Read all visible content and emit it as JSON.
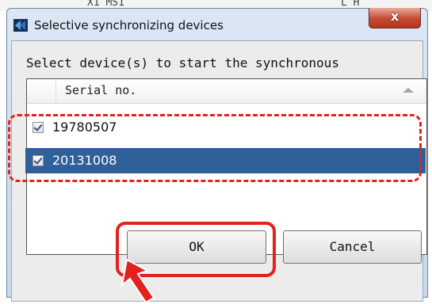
{
  "background": {
    "fragment_left": "X1 MS1",
    "fragment_right": "L H"
  },
  "window": {
    "title": "Selective synchronizing devices",
    "close_label": "x",
    "icon": "app-logo-icon"
  },
  "prompt": "Select device(s) to start the synchronous",
  "list": {
    "column_header": "Serial no.",
    "sort_icon": "sort-ascending-icon",
    "rows": [
      {
        "serial": "19780507",
        "checked": true,
        "selected": false
      },
      {
        "serial": "20131008",
        "checked": true,
        "selected": true
      }
    ]
  },
  "buttons": {
    "ok": "OK",
    "cancel": "Cancel"
  },
  "annotations": {
    "highlight_color": "#e3221d"
  }
}
